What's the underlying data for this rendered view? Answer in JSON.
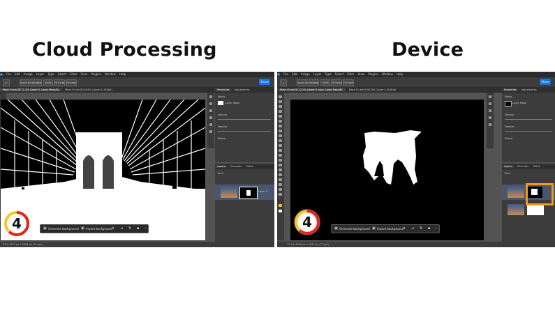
{
  "headings": {
    "left": "Cloud Processing",
    "right": "Device"
  },
  "menu_items": [
    "File",
    "Edit",
    "Image",
    "Layer",
    "Type",
    "Select",
    "Filter",
    "View",
    "Plugins",
    "Window",
    "Help"
  ],
  "options_bar": {
    "zoom_label": "100%",
    "fit_label": "Fit Screen",
    "fill_label": "Fill Screen",
    "scroll_label": "Scroll All Windows",
    "share_label": "Share"
  },
  "panel_tabs": {
    "properties": "Properties",
    "adjustments": "Adjustments",
    "layers": "Layers",
    "channels": "Channels",
    "paths": "Paths"
  },
  "panel_labels": {
    "masks": "Masks",
    "layer_mask": "Layer Mask",
    "density": "Density",
    "feather": "Feather",
    "refine": "Refine",
    "kind": "Kind",
    "layer_name": "Layer 0"
  },
  "contextual_bar": {
    "generate": "Generate background",
    "import": "Import background"
  },
  "left": {
    "doc_tab": "Mask Hi-red @ 72.2% (Layer 0, Layer Mask/8)",
    "doc_tab2": "Mask Hi-red @ 64.8% (Layer 0, RGB/8)",
    "status": "67%    4032 px x 3024 px (72 ppi)",
    "step": "4"
  },
  "right": {
    "doc_tab": "Mask Hi-red @ 72.2% (Layer 0 copy, Layer Mask/8)",
    "doc_tab2": "Mask Hi-red @ 64.8% (Layer 0, RGB/8)",
    "status": "72.2%    4032 px x 3024 px (72 ppi)",
    "step": "4"
  },
  "colors": {
    "ring_red": "#e2241d",
    "ring_yellow": "#f7c42c",
    "highlight": "#f29a18",
    "share": "#1473e6"
  }
}
